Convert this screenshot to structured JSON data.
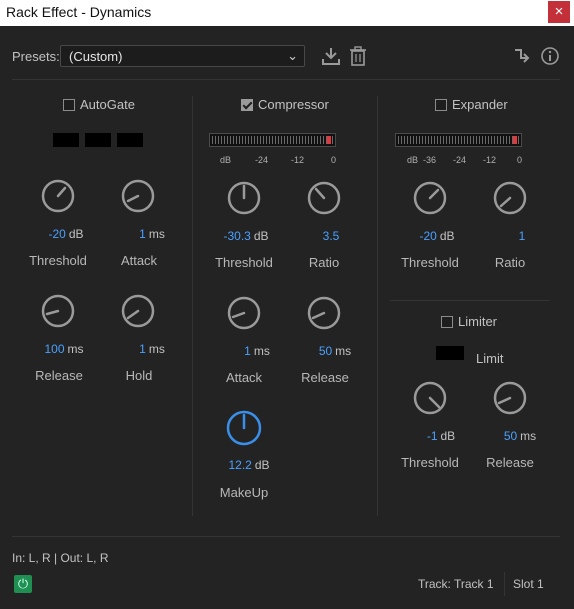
{
  "window": {
    "title": "Rack Effect - Dynamics",
    "close_glyph": "×"
  },
  "presets": {
    "label": "Presets:",
    "value": "(Custom)",
    "chevron": "⌄"
  },
  "autogate": {
    "label": "AutoGate",
    "enabled": false,
    "threshold": {
      "value": "-20",
      "unit": "dB",
      "label": "Threshold"
    },
    "attack": {
      "value": "1",
      "unit": "ms",
      "label": "Attack"
    },
    "release": {
      "value": "100",
      "unit": "ms",
      "label": "Release"
    },
    "hold": {
      "value": "1",
      "unit": "ms",
      "label": "Hold"
    }
  },
  "compressor": {
    "label": "Compressor",
    "enabled": true,
    "meter_scale": [
      "dB",
      "-24",
      "-12",
      "0"
    ],
    "threshold": {
      "value": "-30.3",
      "unit": "dB",
      "label": "Threshold"
    },
    "ratio": {
      "value": "3.5",
      "unit": "",
      "label": "Ratio"
    },
    "attack": {
      "value": "1",
      "unit": "ms",
      "label": "Attack"
    },
    "release": {
      "value": "50",
      "unit": "ms",
      "label": "Release"
    },
    "makeup": {
      "value": "12.2",
      "unit": "dB",
      "label": "MakeUp"
    }
  },
  "expander": {
    "label": "Expander",
    "enabled": false,
    "meter_scale": [
      "dB",
      "-36",
      "-24",
      "-12",
      "0"
    ],
    "threshold": {
      "value": "-20",
      "unit": "dB",
      "label": "Threshold"
    },
    "ratio": {
      "value": "1",
      "unit": "",
      "label": "Ratio"
    }
  },
  "limiter": {
    "label": "Limiter",
    "enabled": false,
    "limit_label": "Limit",
    "threshold": {
      "value": "-1",
      "unit": "dB",
      "label": "Threshold"
    },
    "release": {
      "value": "50",
      "unit": "ms",
      "label": "Release"
    }
  },
  "footer": {
    "io": "In: L, R | Out: L, R",
    "track": "Track: Track 1",
    "slot": "Slot 1",
    "power_glyph": "⏻"
  },
  "colors": {
    "accent": "#4aa0ff",
    "meter_peak": "#e0383f",
    "power": "#1f8f52",
    "close": "#c4303a"
  }
}
